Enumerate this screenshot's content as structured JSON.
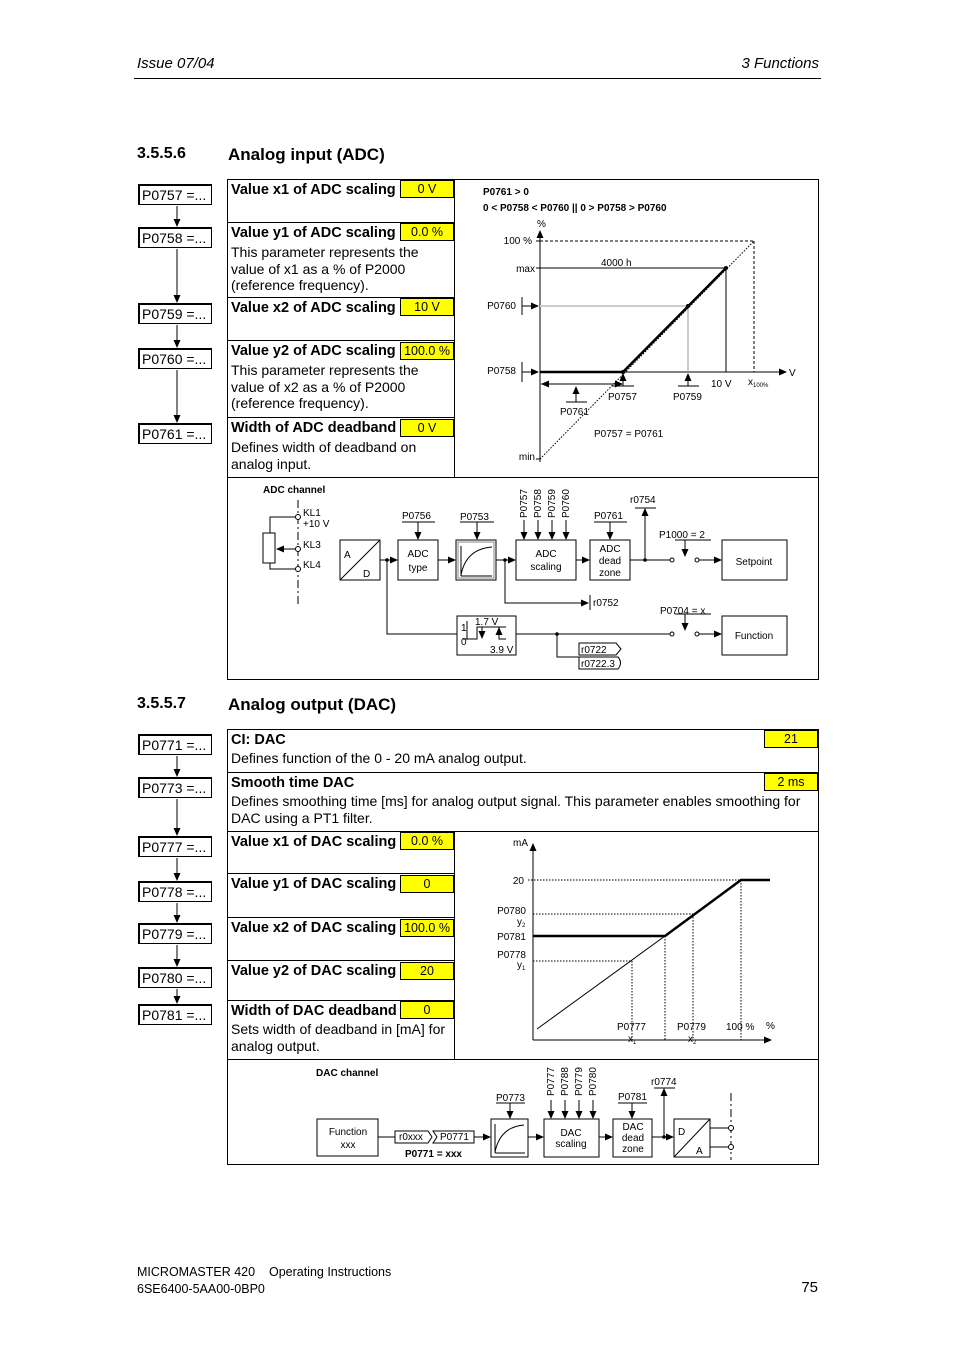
{
  "header": {
    "issue": "Issue 07/04",
    "chapter": "3  Functions"
  },
  "adc": {
    "number": "3.5.5.6",
    "title": "Analog input (ADC)",
    "chain": [
      "P0757 =...",
      "P0758 =...",
      "P0759 =...",
      "P0760 =...",
      "P0761 =..."
    ],
    "params": [
      {
        "name": "Value x1 of ADC scaling",
        "value": "0 V",
        "desc": ""
      },
      {
        "name": "Value y1 of ADC scaling",
        "value": "0.0 %",
        "desc": "This parameter represents the value of x1 as a % of P2000 (reference frequency)."
      },
      {
        "name": "Value x2 of ADC scaling",
        "value": "10 V",
        "desc": ""
      },
      {
        "name": "Value y2 of ADC scaling",
        "value": "100.0 %",
        "desc": "This parameter represents the value of x2 as a % of P2000 (reference frequency)."
      },
      {
        "name": "Width of ADC deadband",
        "value": "0 V",
        "desc": "Defines width of deadband on analog input."
      }
    ],
    "graph": {
      "cond1": "P0761 > 0",
      "cond2": "0 < P0758 < P0760  ||  0 > P0758 > P0760",
      "y_unit": "%",
      "x_unit": "V",
      "y100": "100 %",
      "ymax": "max",
      "ymin": "min",
      "p0760": "P0760",
      "p0758": "P0758",
      "hex": "4000 h",
      "p0761": "P0761",
      "p0757": "P0757",
      "p0759": "P0759",
      "x10v": "10 V",
      "x100": "x",
      "x100_sub": "100%",
      "eq": "P0757 = P0761"
    },
    "channel": {
      "title": "ADC channel",
      "kl1": "KL1",
      "v10": "+10 V",
      "kl3": "KL3",
      "kl4": "KL4",
      "a": "A",
      "d": "D",
      "p0756": "P0756",
      "type1": "ADC",
      "type2": "type",
      "p0753": "P0753",
      "scaling_params": [
        "P0757",
        "P0758",
        "P0759",
        "P0760"
      ],
      "scal1": "ADC",
      "scal2": "scaling",
      "p0761": "P0761",
      "dz1": "ADC",
      "dz2": "dead",
      "dz3": "zone",
      "r0754": "r0754",
      "r0752": "r0752",
      "p1000": "P1000 = 2",
      "setpoint": "Setpoint",
      "h1": "1",
      "h0": "0",
      "h17": "1.7 V",
      "h39": "3.9 V",
      "p0704": "P0704 = x",
      "function": "Function",
      "r0722": "r0722",
      "r07223": "r0722.3"
    }
  },
  "dac": {
    "number": "3.5.5.7",
    "title": "Analog output (DAC)",
    "chain": [
      "P0771 =...",
      "P0773 =...",
      "P0777 =...",
      "P0778 =...",
      "P0779 =...",
      "P0780 =...",
      "P0781 =..."
    ],
    "wide_params": [
      {
        "name": "CI: DAC",
        "value": "21",
        "desc": "Defines function of the 0 - 20 mA analog output."
      },
      {
        "name": "Smooth time DAC",
        "value": "2 ms",
        "desc": "Defines smoothing time [ms] for analog output signal. This parameter enables smoothing for DAC using a PT1 filter."
      }
    ],
    "params": [
      {
        "name": "Value x1 of DAC scaling",
        "value": "0.0 %",
        "desc": ""
      },
      {
        "name": "Value y1 of DAC scaling",
        "value": "0",
        "desc": ""
      },
      {
        "name": "Value x2 of DAC scaling",
        "value": "100.0 %",
        "desc": ""
      },
      {
        "name": "Value y2 of DAC scaling",
        "value": "20",
        "desc": ""
      },
      {
        "name": "Width of DAC deadband",
        "value": "0",
        "desc": "Sets width of deadband in [mA] for analog output."
      }
    ],
    "graph": {
      "y_unit": "mA",
      "x_unit": "%",
      "y20": "20",
      "p0780": "P0780",
      "y2": "y",
      "y2s": "2",
      "p0781": "P0781",
      "p0778": "P0778",
      "y1": "y",
      "y1s": "1",
      "p0777": "P0777",
      "x1": "x",
      "x1s": "1",
      "p0779": "P0779",
      "x2": "x",
      "x2s": "2",
      "x100": "100 %"
    },
    "channel": {
      "title": "DAC channel",
      "func1": "Function",
      "func2": "xxx",
      "r0xxx": "r0xxx",
      "p0771": "P0771",
      "p0771eq": "P0771 = xxx",
      "p0773": "P0773",
      "scaling_params": [
        "P0777",
        "P0788",
        "P0779",
        "P0780"
      ],
      "scal1": "DAC",
      "scal2": "scaling",
      "p0781": "P0781",
      "dz1": "DAC",
      "dz2": "dead",
      "dz3": "zone",
      "r0774": "r0774",
      "d": "D",
      "a": "A"
    }
  },
  "footer": {
    "product": "MICROMASTER 420    Operating Instructions",
    "order": "6SE6400-5AA00-0BP0",
    "page": "75"
  },
  "colors": {
    "value_highlight": "#ffff00"
  }
}
